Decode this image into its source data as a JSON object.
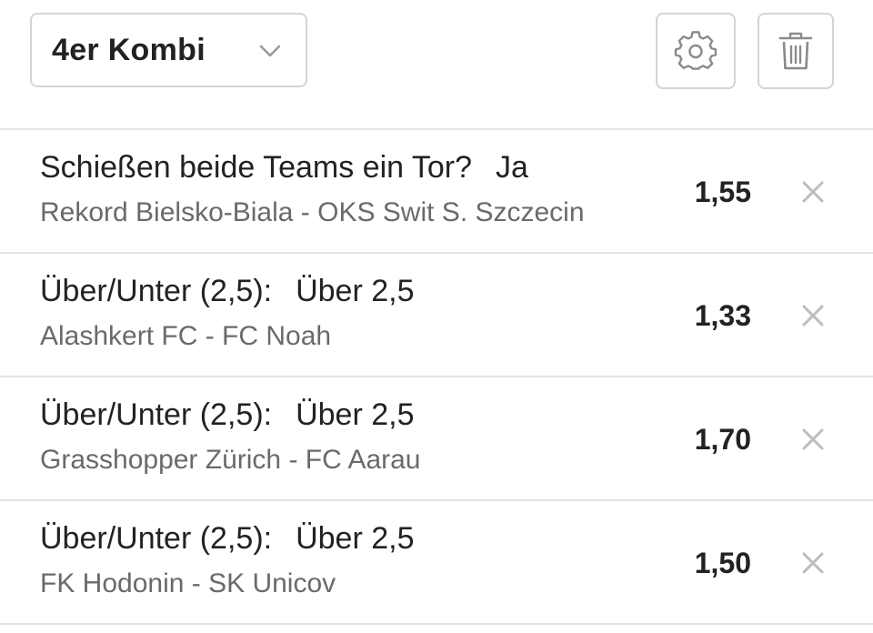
{
  "header": {
    "bet_type": "4er Kombi",
    "icons": {
      "dropdown": "chevron-down-icon",
      "settings": "gear-icon",
      "delete": "trash-icon"
    }
  },
  "colors": {
    "border": "#d4d4d4",
    "text_primary": "#222222",
    "text_secondary": "#6a6a6a",
    "icon": "#8a8a8a",
    "remove_icon": "#bdbdbd"
  },
  "bets": [
    {
      "market": "Schießen beide Teams ein Tor?",
      "selection": "Ja",
      "event": "Rekord Bielsko-Biala - OKS Swit S. Szczecin",
      "odds": "1,55"
    },
    {
      "market": "Über/Unter (2,5):",
      "selection": "Über 2,5",
      "event": "Alashkert FC - FC Noah",
      "odds": "1,33"
    },
    {
      "market": "Über/Unter (2,5):",
      "selection": "Über 2,5",
      "event": "Grasshopper Zürich - FC Aarau",
      "odds": "1,70"
    },
    {
      "market": "Über/Unter (2,5):",
      "selection": "Über 2,5",
      "event": "FK Hodonin - SK Unicov",
      "odds": "1,50"
    }
  ]
}
